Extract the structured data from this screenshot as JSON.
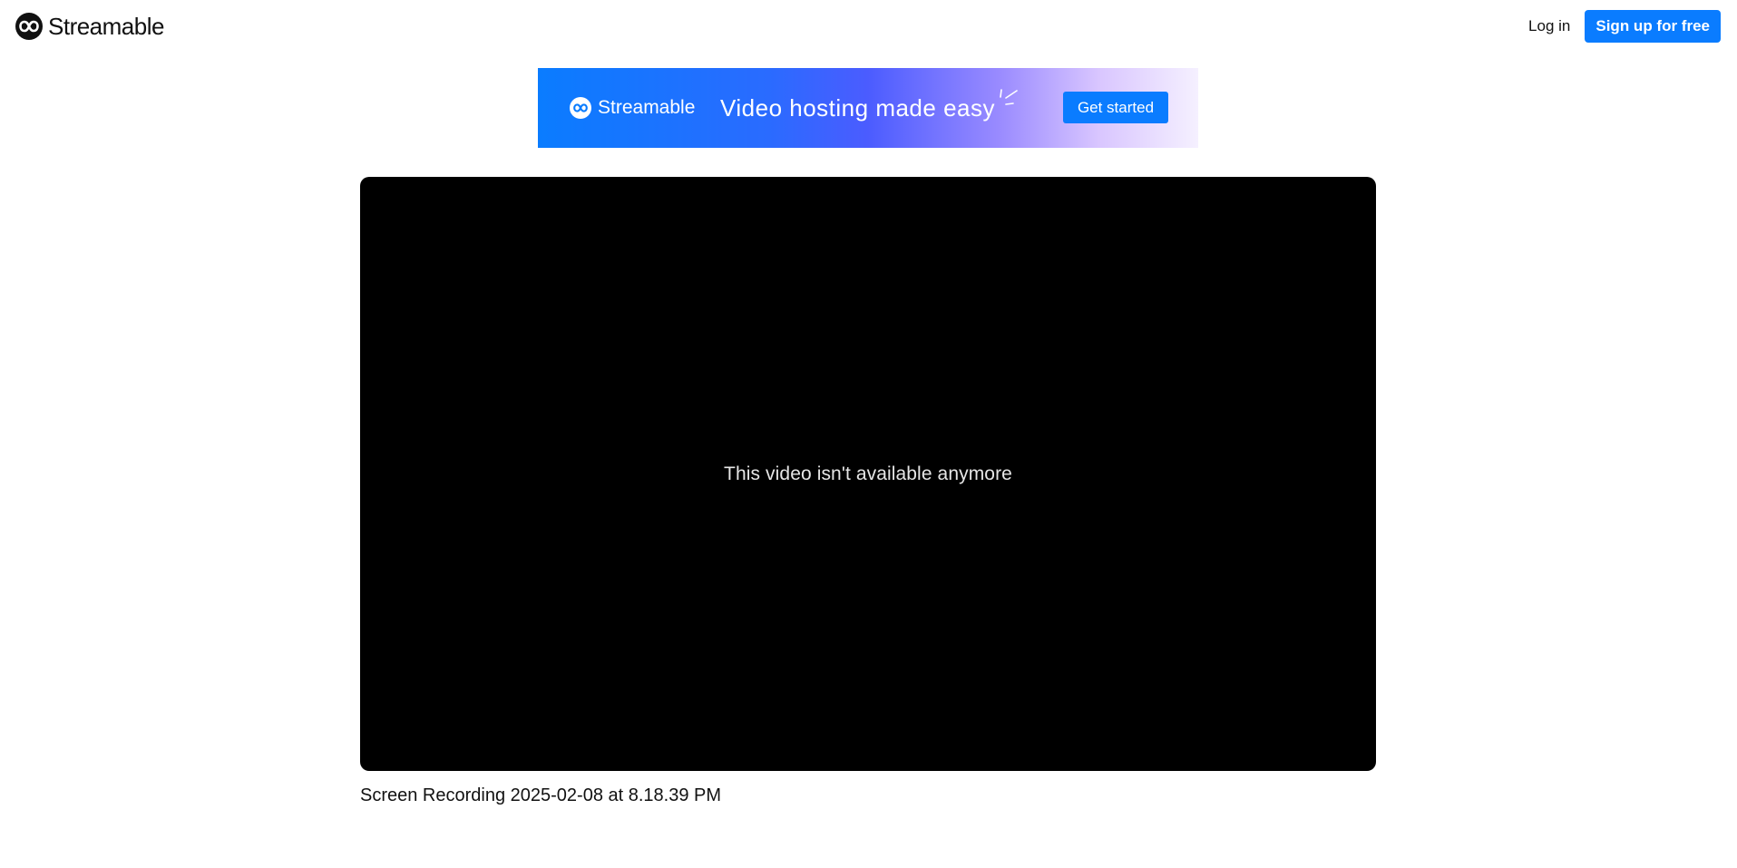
{
  "header": {
    "brand_name": "Streamable",
    "login_label": "Log in",
    "signup_label": "Sign up for free"
  },
  "banner": {
    "brand_name": "Streamable",
    "headline": "Video hosting made easy",
    "cta_label": "Get started"
  },
  "player": {
    "message": "This video isn't available anymore"
  },
  "video": {
    "title": "Screen Recording 2025-02-08 at 8.18.39 PM"
  },
  "colors": {
    "accent": "#0a7cff",
    "player_bg": "#000000"
  },
  "icons": {
    "brand": "streamable-infinity-logo",
    "sparkle": "sparkle-lines"
  }
}
